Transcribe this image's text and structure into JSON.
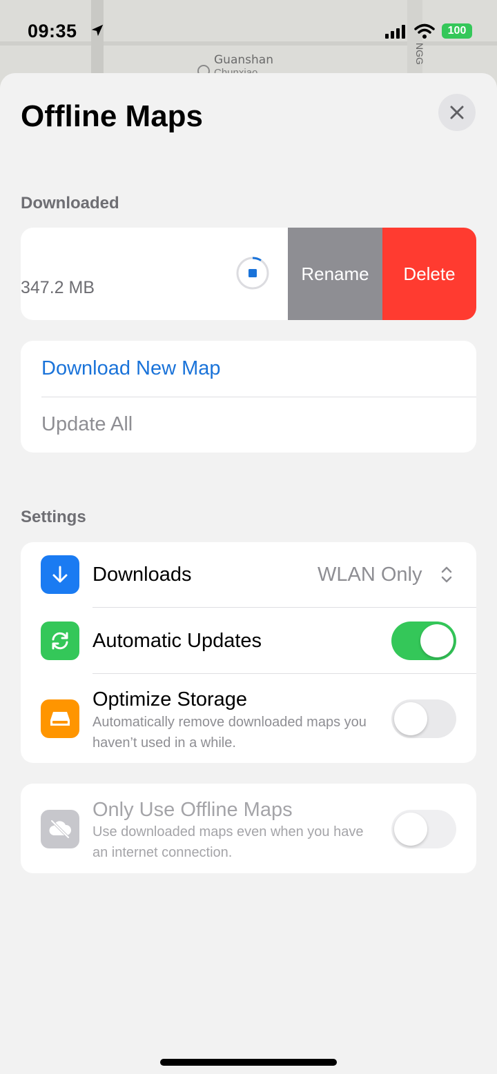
{
  "map": {
    "label": "Guanshan",
    "label2": "Chunxiao",
    "vertical_label": "NGG"
  },
  "status_bar": {
    "time": "09:35",
    "battery": "100"
  },
  "sheet": {
    "title": "Offline Maps"
  },
  "downloaded": {
    "section_label": "Downloaded",
    "item": {
      "size": "347.2 MB",
      "rename_label": "Rename",
      "delete_label": "Delete"
    }
  },
  "actions": {
    "download_new": "Download New Map",
    "update_all": "Update All"
  },
  "settings": {
    "section_label": "Settings",
    "downloads": {
      "label": "Downloads",
      "value": "WLAN Only"
    },
    "auto_updates": {
      "label": "Automatic Updates",
      "enabled": true
    },
    "optimize": {
      "label": "Optimize Storage",
      "sub": "Automatically remove downloaded maps you haven’t used in a while.",
      "enabled": false
    },
    "offline_only": {
      "label": "Only Use Offline Maps",
      "sub": "Use downloaded maps even when you have an internet connection.",
      "enabled": false
    }
  },
  "colors": {
    "accent": "#1a73d9",
    "toggle_on": "#34c759",
    "delete": "#ff3b30",
    "rename": "#8e8e93",
    "storage_icon": "#ff9500"
  }
}
